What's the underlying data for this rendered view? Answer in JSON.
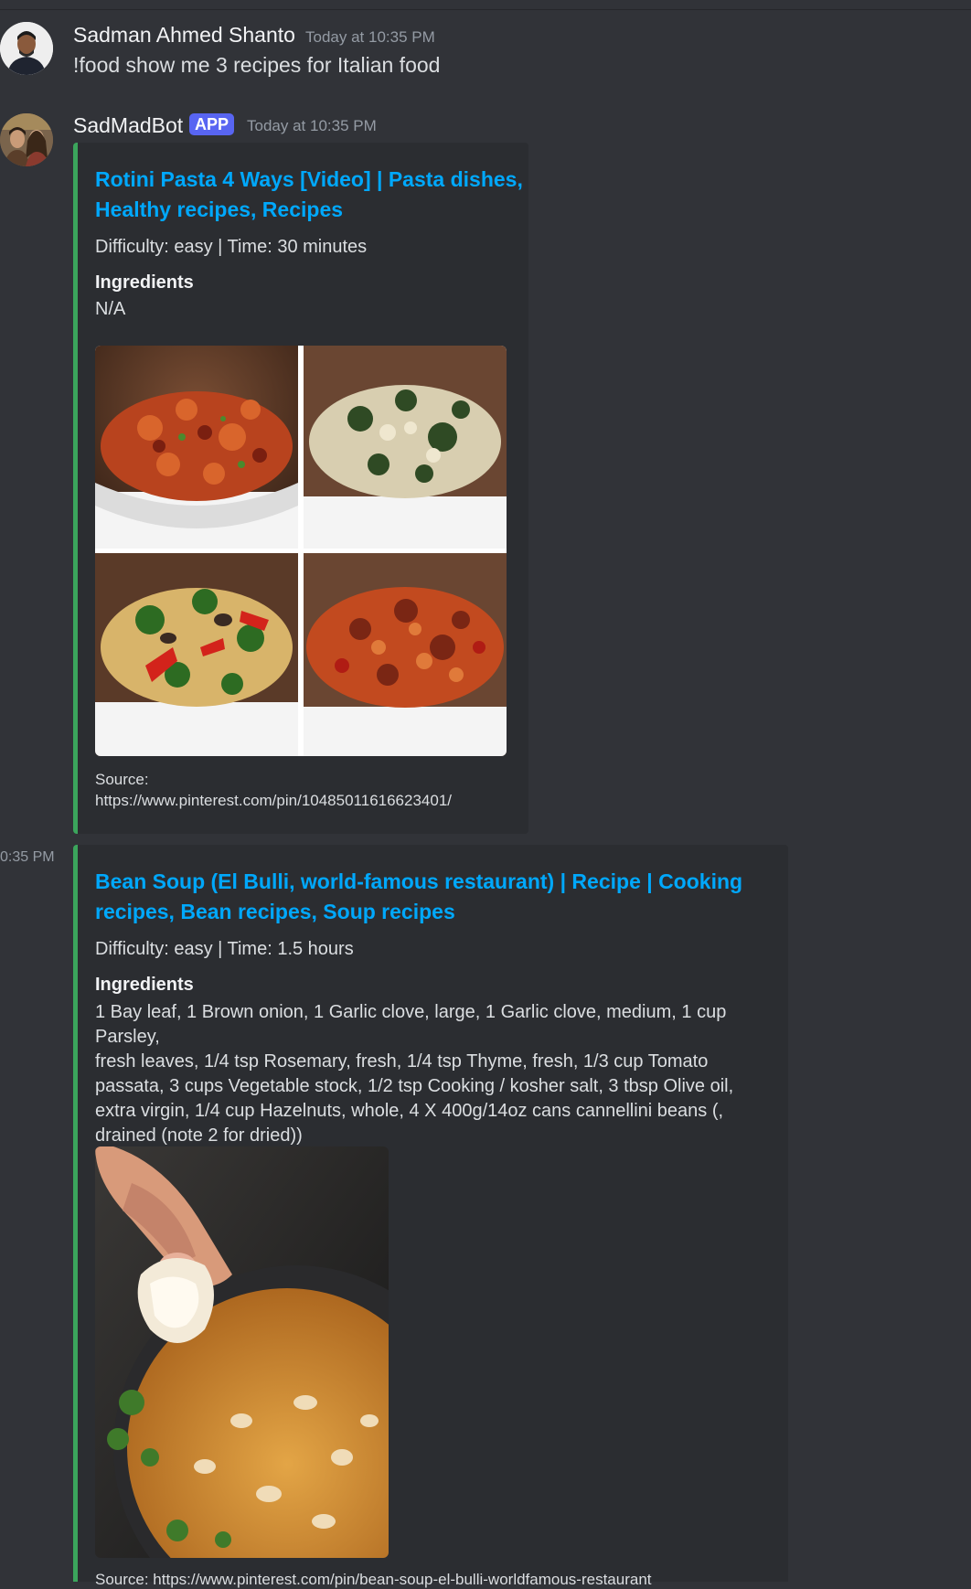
{
  "message1": {
    "author": "Sadman Ahmed Shanto",
    "timestamp": "Today at 10:35 PM",
    "text": "!food show me 3 recipes for Italian food"
  },
  "message2": {
    "author": "SadMadBot",
    "badge": "APP",
    "timestamp": "Today at 10:35 PM"
  },
  "embed1": {
    "title_line1": "Rotini Pasta 4 Ways [Video] | Pasta dishes,",
    "title_line2": "Healthy recipes, Recipes",
    "meta": "Difficulty: easy | Time: 30 minutes",
    "ingredients_label": "Ingredients",
    "ingredients": "N/A",
    "source_label": "Source:",
    "source_url": "https://www.pinterest.com/pin/10485011616623401/"
  },
  "embed2": {
    "gutter_time": "0:35 PM",
    "title_line1": "Bean Soup (El Bulli, world-famous restaurant) | Recipe | Cooking",
    "title_line2": "recipes, Bean recipes, Soup recipes",
    "meta": "Difficulty: easy | Time: 1.5 hours",
    "ingredients_label": "Ingredients",
    "ingredients_lines": [
      "1 Bay leaf, 1 Brown onion, 1 Garlic clove, large, 1 Garlic clove, medium, 1 cup Parsley,",
      "fresh leaves, 1/4 tsp Rosemary, fresh, 1/4 tsp Thyme, fresh, 1/3 cup Tomato",
      "passata, 3 cups Vegetable stock, 1/2 tsp Cooking / kosher salt, 3 tbsp Olive oil,",
      "extra virgin, 1/4 cup Hazelnuts, whole, 4 X 400g/14oz cans cannellini beans (,",
      "drained (note 2 for dried))"
    ],
    "source_partial": "Source: https://www.pinterest.com/pin/bean-soup-el-bulli-worldfamous-restaurant"
  },
  "colors": {
    "background": "#313338",
    "embed_bg": "#2b2d31",
    "embed_border": "#3ba55c",
    "link": "#00a8fc",
    "badge": "#5865f2"
  }
}
